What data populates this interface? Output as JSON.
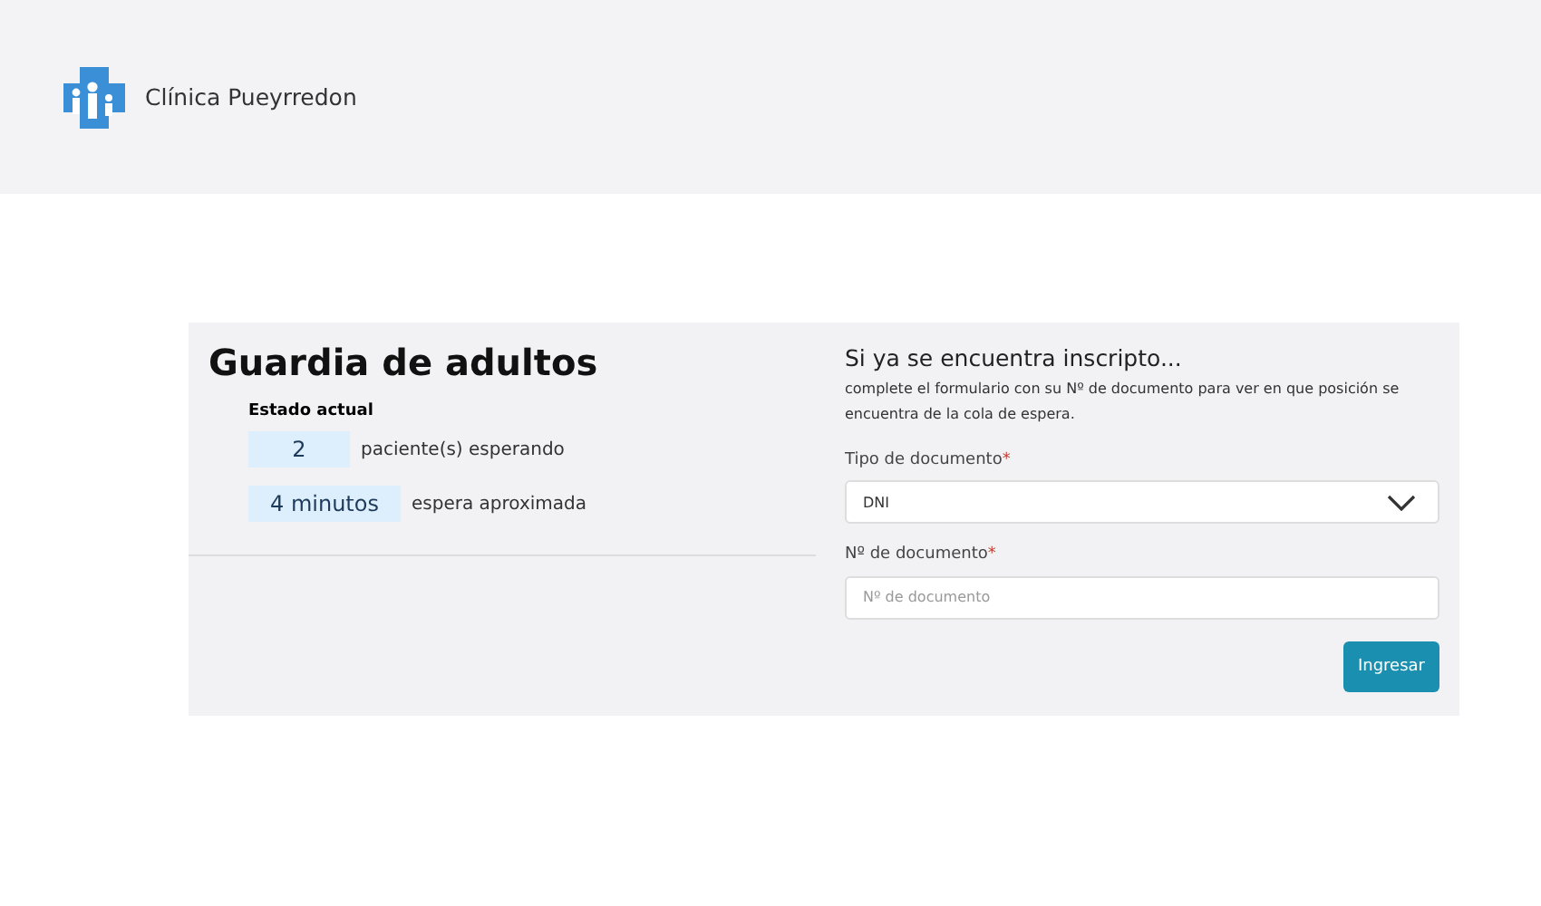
{
  "header": {
    "brand": "Clínica Pueyrredon"
  },
  "status": {
    "title": "Guardia de adultos",
    "subtitle": "Estado actual",
    "stats": [
      {
        "value": "2",
        "label": "paciente(s) esperando"
      },
      {
        "value": "4 minutos",
        "label": "espera aproximada"
      }
    ]
  },
  "form": {
    "heading": "Si ya se encuentra inscripto...",
    "description": "complete el formulario con su Nº de documento para ver en que posición se encuentra de la cola de espera.",
    "fields": [
      {
        "kind": "select",
        "label": "Tipo de documento",
        "required_mark": "*",
        "value": "DNI"
      },
      {
        "kind": "text",
        "label": "Nº de documento",
        "required_mark": "*",
        "placeholder": "Nº de documento"
      }
    ],
    "submit": "Ingresar"
  }
}
